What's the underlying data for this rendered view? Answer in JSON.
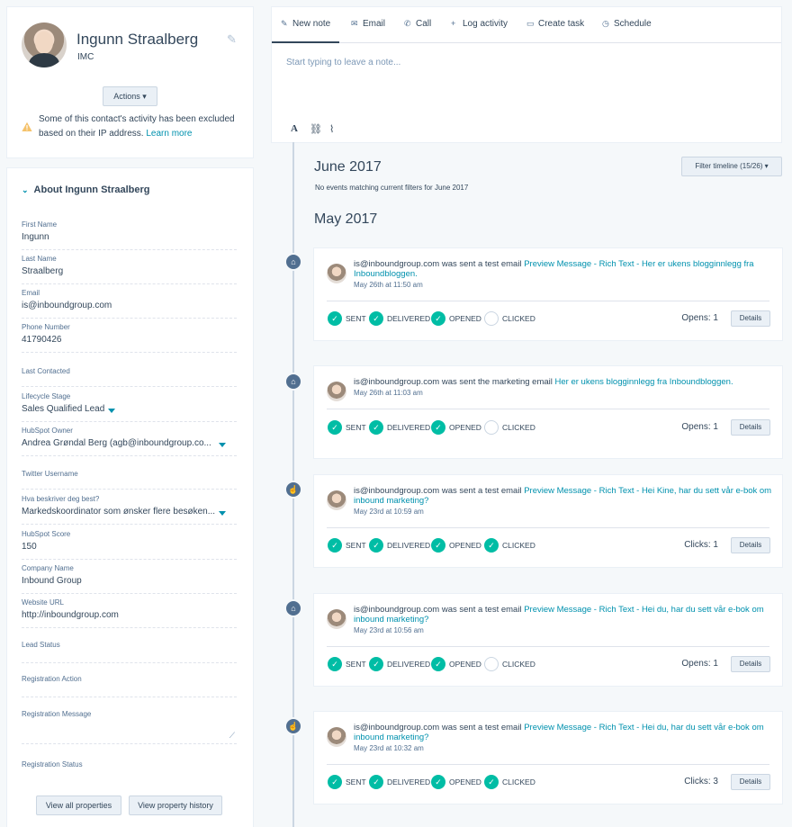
{
  "profile": {
    "name": "Ingunn Straalberg",
    "company": "IMC",
    "actions_label": "Actions ▾",
    "warning": "Some of this contact's activity has been excluded based on their IP address.",
    "learn_more": "Learn more"
  },
  "about": {
    "header": "About Ingunn Straalberg",
    "fields": [
      {
        "label": "First Name",
        "value": "Ingunn"
      },
      {
        "label": "Last Name",
        "value": "Straalberg"
      },
      {
        "label": "Email",
        "value": "is@inboundgroup.com"
      },
      {
        "label": "Phone Number",
        "value": "41790426"
      },
      {
        "label": "Last Contacted",
        "value": ""
      },
      {
        "label": "Lifecycle Stage",
        "value": "Sales Qualified Lead"
      },
      {
        "label": "HubSpot Owner",
        "value": "Andrea Grøndal Berg (agb@inboundgroup.co..."
      },
      {
        "label": "Twitter Username",
        "value": ""
      },
      {
        "label": "Hva beskriver deg best?",
        "value": "Markedskoordinator som ønsker flere besøken..."
      },
      {
        "label": "HubSpot Score",
        "value": "150"
      },
      {
        "label": "Company Name",
        "value": "Inbound Group"
      },
      {
        "label": "Website URL",
        "value": "http://inboundgroup.com"
      },
      {
        "label": "Lead Status",
        "value": ""
      },
      {
        "label": "Registration Action",
        "value": ""
      },
      {
        "label": "Registration Message",
        "value": ""
      },
      {
        "label": "Registration Status",
        "value": ""
      }
    ],
    "view_all": "View all properties",
    "view_history": "View property history"
  },
  "composer": {
    "tabs": [
      {
        "icon": "✎",
        "label": "New note"
      },
      {
        "icon": "✉",
        "label": "Email"
      },
      {
        "icon": "✆",
        "label": "Call"
      },
      {
        "icon": "+",
        "label": "Log activity"
      },
      {
        "icon": "▭",
        "label": "Create task"
      },
      {
        "icon": "◷",
        "label": "Schedule"
      }
    ],
    "placeholder": "Start typing to leave a note..."
  },
  "timeline": {
    "filter_label": "Filter timeline (15/26) ▾",
    "months": [
      {
        "label": "June 2017",
        "note": "No events matching current filters for June 2017"
      },
      {
        "label": "May 2017",
        "note": ""
      }
    ],
    "events": [
      {
        "node_icon": "email-icon",
        "sender": "is@inboundgroup.com",
        "action": " was sent a test email ",
        "subject": "Preview Message - Rich Text - Her er ukens blogginnlegg fra Inboundbloggen.",
        "date": "May 26th at 11:50 am",
        "statuses": [
          {
            "label": "SENT",
            "done": true
          },
          {
            "label": "DELIVERED",
            "done": true
          },
          {
            "label": "OPENED",
            "done": true
          },
          {
            "label": "CLICKED",
            "done": false
          }
        ],
        "stat_label": "Opens: 1",
        "details": "Details"
      },
      {
        "node_icon": "email-icon",
        "sender": "is@inboundgroup.com",
        "action": " was sent the marketing email ",
        "subject": "Her er ukens blogginnlegg fra Inboundbloggen.",
        "date": "May 26th at 11:03 am",
        "statuses": [
          {
            "label": "SENT",
            "done": true
          },
          {
            "label": "DELIVERED",
            "done": true
          },
          {
            "label": "OPENED",
            "done": true
          },
          {
            "label": "CLICKED",
            "done": false
          }
        ],
        "stat_label": "Opens: 1",
        "details": "Details"
      },
      {
        "node_icon": "click-icon",
        "sender": "is@inboundgroup.com",
        "action": " was sent a test email ",
        "subject": "Preview Message - Rich Text - Hei Kine, har du sett vår e-bok om inbound marketing?",
        "date": "May 23rd at 10:59 am",
        "statuses": [
          {
            "label": "SENT",
            "done": true
          },
          {
            "label": "DELIVERED",
            "done": true
          },
          {
            "label": "OPENED",
            "done": true
          },
          {
            "label": "CLICKED",
            "done": true
          }
        ],
        "stat_label": "Clicks: 1",
        "details": "Details"
      },
      {
        "node_icon": "email-icon",
        "sender": "is@inboundgroup.com",
        "action": " was sent a test email ",
        "subject": "Preview Message - Rich Text - Hei du, har du sett vår e-bok om inbound marketing?",
        "date": "May 23rd at 10:56 am",
        "statuses": [
          {
            "label": "SENT",
            "done": true
          },
          {
            "label": "DELIVERED",
            "done": true
          },
          {
            "label": "OPENED",
            "done": true
          },
          {
            "label": "CLICKED",
            "done": false
          }
        ],
        "stat_label": "Opens: 1",
        "details": "Details"
      },
      {
        "node_icon": "click-icon",
        "sender": "is@inboundgroup.com",
        "action": " was sent a test email ",
        "subject": "Preview Message - Rich Text - Hei du, har du sett vår e-bok om inbound marketing?",
        "date": "May 23rd at 10:32 am",
        "statuses": [
          {
            "label": "SENT",
            "done": true
          },
          {
            "label": "DELIVERED",
            "done": true
          },
          {
            "label": "OPENED",
            "done": true
          },
          {
            "label": "CLICKED",
            "done": true
          }
        ],
        "stat_label": "Clicks: 3",
        "details": "Details"
      }
    ]
  }
}
